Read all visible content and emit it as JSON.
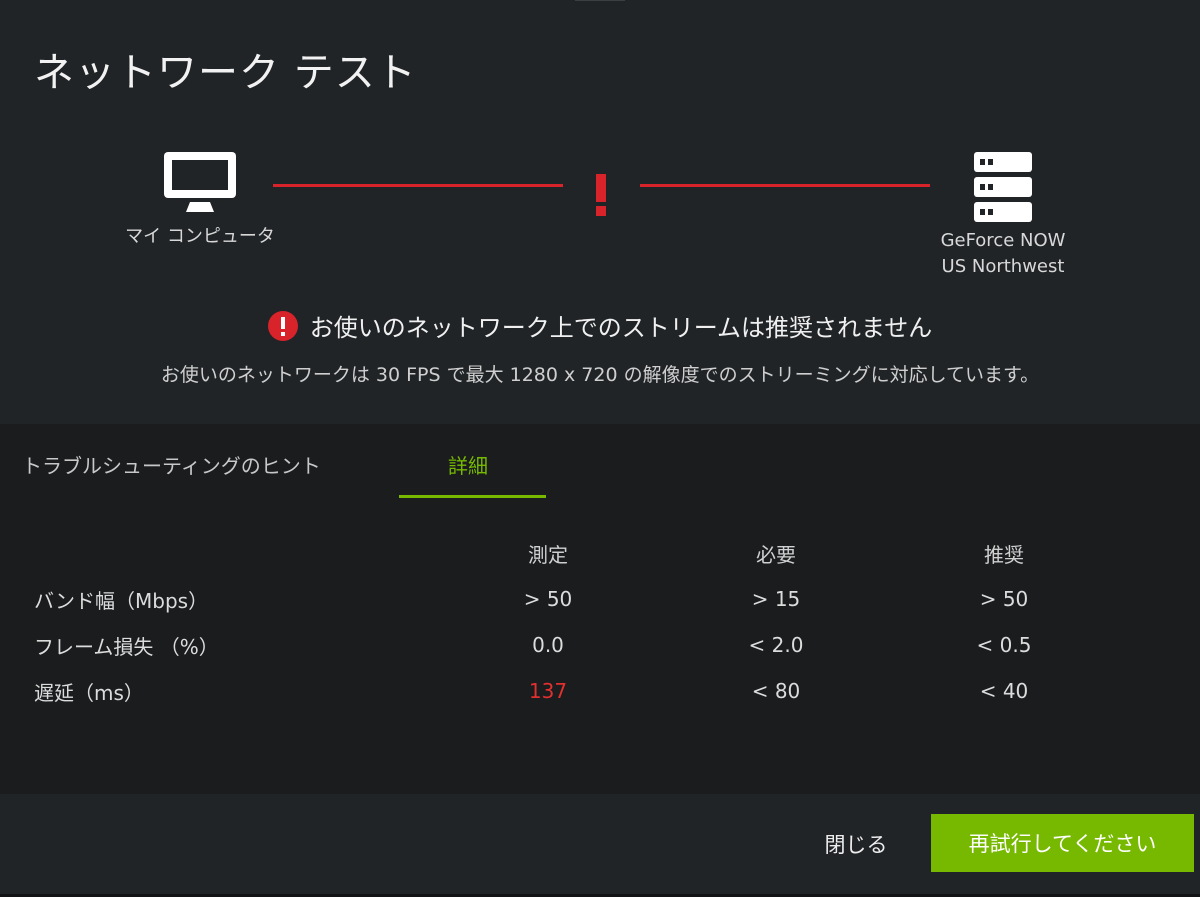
{
  "dialog": {
    "title": "ネットワーク テスト"
  },
  "diagram": {
    "client": {
      "label": "マイ コンピュータ",
      "icon": "monitor-icon"
    },
    "server": {
      "label_line1": "GeForce NOW",
      "label_line2": "US Northwest",
      "icon": "server-icon"
    },
    "link_status": "error",
    "link_color": "#d8232a"
  },
  "status": {
    "headline": "お使いのネットワーク上でのストリームは推奨されません",
    "detail": "お使いのネットワークは 30 FPS で最大 1280 x 720 の解像度でのストリーミングに対応しています。",
    "icon": "alert-icon"
  },
  "tabs": [
    {
      "label": "トラブルシューティングのヒント",
      "active": false
    },
    {
      "label": "詳細",
      "active": true
    }
  ],
  "metrics": {
    "headers": [
      "測定",
      "必要",
      "推奨"
    ],
    "rows": [
      {
        "label": "バンド幅（Mbps）",
        "measured": "> 50",
        "required": "> 15",
        "recommended": "> 50"
      },
      {
        "label": "フレーム損失 （%）",
        "measured": "0.0",
        "required": "< 2.0",
        "recommended": "< 0.5"
      },
      {
        "label": "遅延（ms）",
        "measured": "137",
        "required": "< 80",
        "recommended": "< 40",
        "measured_status": "bad"
      }
    ]
  },
  "footer": {
    "close_label": "閉じる",
    "retry_label": "再試行してください"
  },
  "colors": {
    "accent": "#76b900",
    "error": "#d8232a",
    "background": "#202427"
  }
}
